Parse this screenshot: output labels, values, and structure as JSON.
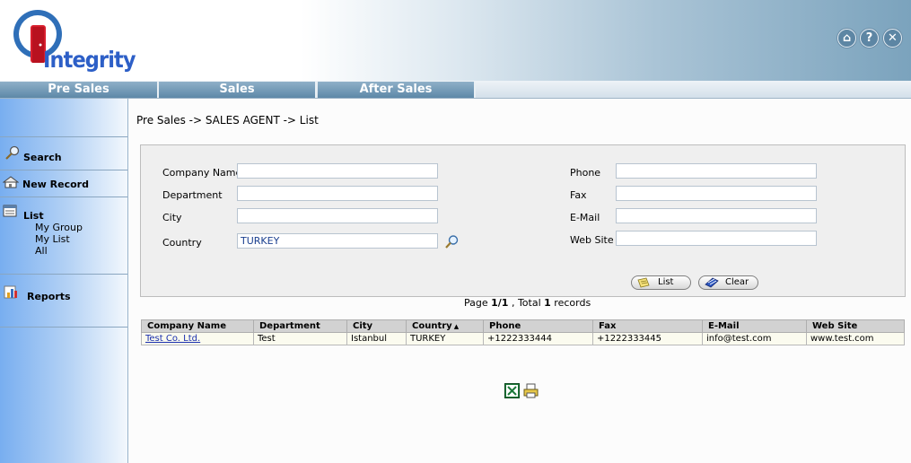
{
  "app": {
    "logo_text": "Integrity"
  },
  "header_icons": [
    {
      "name": "home-icon",
      "glyph": "⌂"
    },
    {
      "name": "help-icon",
      "glyph": "?"
    },
    {
      "name": "close-icon",
      "glyph": "✕"
    }
  ],
  "nav": {
    "tabs": [
      "Pre Sales",
      "Sales",
      "After Sales"
    ]
  },
  "sidebar": {
    "search": "Search",
    "new_record": "New Record",
    "list": "List",
    "list_items": [
      "My Group",
      "My List",
      "All"
    ],
    "reports": "Reports"
  },
  "breadcrumb": "Pre Sales -> SALES AGENT -> List",
  "form": {
    "company_name_label": "Company Name",
    "department_label": "Department",
    "city_label": "City",
    "country_label": "Country",
    "country_value": "TURKEY",
    "phone_label": "Phone",
    "fax_label": "Fax",
    "email_label": "E-Mail",
    "website_label": "Web Site",
    "list_button": "List",
    "clear_button": "Clear"
  },
  "pagination": {
    "prefix": "Page ",
    "page": "1/1",
    "middle": " , Total ",
    "total": "1",
    "suffix": " records"
  },
  "table": {
    "headers": [
      "Company Name",
      "Department",
      "City",
      "Country",
      "Phone",
      "Fax",
      "E-Mail",
      "Web Site"
    ],
    "sort_indicator": "▲",
    "rows": [
      [
        "Test Co. Ltd.",
        "Test",
        "Istanbul",
        "TURKEY",
        "+1222333444",
        "+1222333445",
        "info@test.com",
        "www.test.com"
      ]
    ]
  },
  "colors": {
    "accent": "#5d88a8",
    "link": "#1a2fae",
    "sidebar": "#78aef0"
  }
}
